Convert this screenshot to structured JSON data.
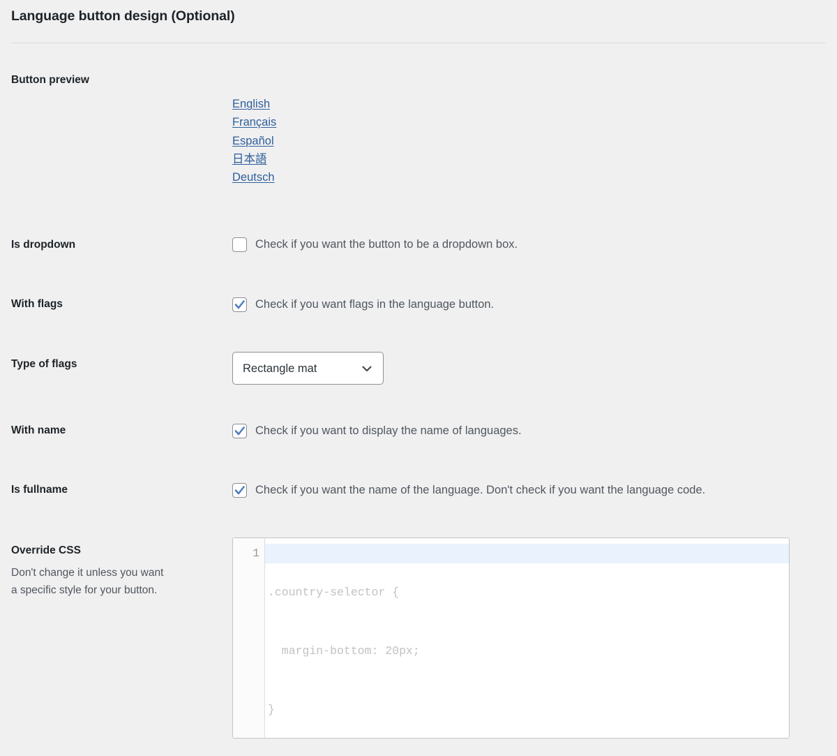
{
  "section": {
    "title": "Language button design (Optional)"
  },
  "preview": {
    "label": "Button preview",
    "link_color": "#2e5f9a",
    "languages": [
      {
        "name": "English"
      },
      {
        "name": "Français"
      },
      {
        "name": "Español"
      },
      {
        "name": "日本語"
      },
      {
        "name": "Deutsch"
      }
    ]
  },
  "fields": {
    "is_dropdown": {
      "label": "Is dropdown",
      "description": "Check if you want the button to be a dropdown box.",
      "checked": false
    },
    "with_flags": {
      "label": "With flags",
      "description": "Check if you want flags in the language button.",
      "checked": true
    },
    "type_of_flags": {
      "label": "Type of flags",
      "value": "Rectangle mat",
      "chevron_icon": "chevron-down-icon"
    },
    "with_name": {
      "label": "With name",
      "description": "Check if you want to display the name of languages.",
      "checked": true
    },
    "is_fullname": {
      "label": "Is fullname",
      "description": "Check if you want the name of the language. Don't check if you want the language code.",
      "checked": true
    },
    "override_css": {
      "label": "Override CSS",
      "help_line_1": "Don't change it unless you want",
      "help_line_2": "a specific style for your button.",
      "line_number": "1",
      "placeholder_lines": [
        ".country-selector {",
        "  margin-bottom: 20px;",
        "}"
      ]
    }
  },
  "colors": {
    "background": "#f0f0f1",
    "checkmark": "#4f7fbf",
    "border": "#8c8f94",
    "text": "#1d2327",
    "muted_text": "#50575e"
  }
}
